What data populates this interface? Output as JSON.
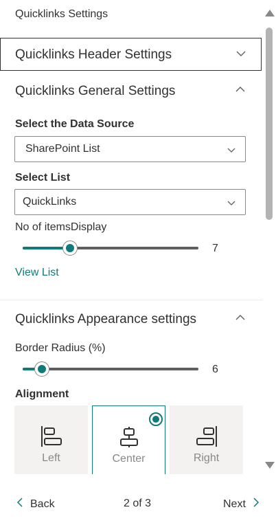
{
  "pane": {
    "title": "Quicklinks Settings"
  },
  "header_section": {
    "title": "Quicklinks Header Settings",
    "chevron_icon": "chevron-down-icon",
    "expanded": false
  },
  "general_section": {
    "title": "Quicklinks General Settings",
    "chevron_icon": "chevron-up-icon",
    "expanded": true,
    "data_source": {
      "label": "Select the Data Source",
      "value": "SharePoint List"
    },
    "list": {
      "label": "Select List",
      "value": "QuickLinks"
    },
    "items_display": {
      "label": "No of itemsDisplay",
      "value": "7",
      "fill_fraction": 0.27
    },
    "view_list_link": "View List"
  },
  "appearance_section": {
    "title": "Quicklinks Appearance settings",
    "chevron_icon": "chevron-up-icon",
    "expanded": true,
    "border_radius": {
      "label": "Border Radius (%)",
      "value": "6",
      "fill_fraction": 0.11
    },
    "alignment": {
      "label": "Alignment",
      "options": [
        {
          "label": "Left",
          "icon": "align-left-icon",
          "selected": false
        },
        {
          "label": "Center",
          "icon": "align-center-icon",
          "selected": true
        },
        {
          "label": "Right",
          "icon": "align-right-icon",
          "selected": false
        }
      ]
    }
  },
  "footer": {
    "back_label": "Back",
    "page_indicator": "2 of 3",
    "next_label": "Next"
  },
  "colors": {
    "accent": "#0f7a7a",
    "text": "#323130",
    "muted": "#8a8886",
    "choice_bg": "#f3f2f1"
  }
}
